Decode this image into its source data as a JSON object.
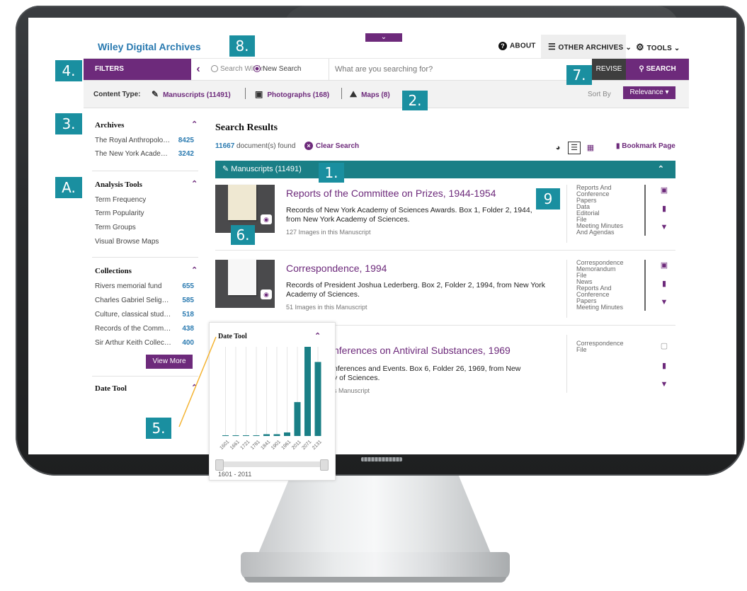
{
  "app": {
    "brand": "Wiley Digital Archives",
    "top_links": {
      "about": "ABOUT",
      "other_archives": "OTHER ARCHIVES",
      "tools": "TOOLS"
    }
  },
  "search": {
    "filters_label": "FILTERS",
    "search_within": "Search Within",
    "new_search": "New Search",
    "placeholder": "What are you searching for?",
    "revise": "REVISE",
    "search_button": "SEARCH"
  },
  "content_type": {
    "label": "Content Type:",
    "manuscripts": "Manuscripts (11491)",
    "photographs": "Photographs (168)",
    "maps": "Maps (8)",
    "sort_label": "Sort By",
    "sort_value": "Relevance"
  },
  "left": {
    "archives_title": "Archives",
    "archives": [
      {
        "label": "The Royal Anthropologic...",
        "count": "8425"
      },
      {
        "label": "The New York Academy ...",
        "count": "3242"
      }
    ],
    "analysis_title": "Analysis Tools",
    "analysis_items": [
      "Term Frequency",
      "Term Popularity",
      "Term Groups",
      "Visual Browse Maps"
    ],
    "collections_title": "Collections",
    "collections": [
      {
        "label": "Rivers memorial fund",
        "count": "655"
      },
      {
        "label": "Charles Gabriel Seligma...",
        "count": "585"
      },
      {
        "label": "Culture, classical studies...",
        "count": "518"
      },
      {
        "label": "Records of the Committ...",
        "count": "438"
      },
      {
        "label": "Sir Arthur Keith Collection",
        "count": "400"
      }
    ],
    "view_more": "View More",
    "date_tool_title": "Date Tool"
  },
  "main": {
    "results_title": "Search Results",
    "found_count": "11667",
    "found_suffix": "document(s) found",
    "clear_search": "Clear Search",
    "bookmark_page": "Bookmark Page",
    "group_label": "Manuscripts (11491)",
    "results": [
      {
        "title": "Reports of the Committee on Prizes, 1944-1954",
        "desc": "Records of New York Academy of Sciences Awards. Box 1, Folder 2, 1944, from New York Academy of Sciences.",
        "meta": "127 Images in this Manuscript",
        "tags": [
          "Reports And",
          "Conference",
          "Papers",
          "Data",
          "Editorial",
          "File",
          "Meeting Minutes",
          "And Agendas"
        ]
      },
      {
        "title": "Correspondence, 1994",
        "desc": "Records of President Joshua Lederberg. Box 2, Folder 2, 1994, from New York Academy of Sciences.",
        "meta": "51 Images in this Manuscript",
        "tags": [
          "Correspondence",
          "Memorandum",
          "File",
          "News",
          "Reports And",
          "Conference",
          "Papers",
          "Meeting Minutes"
        ]
      },
      {
        "title": "nferences on Antiviral Substances, 1969",
        "desc_line1": "nferences and Events. Box 6, Folder 26, 1969, from New",
        "desc_line2": "y of Sciences.",
        "meta": "s Manuscript",
        "tags": [
          "Correspondence",
          "File"
        ]
      }
    ]
  },
  "date_tool": {
    "title": "Date Tool",
    "range": "1601 - 2011",
    "chart_data": {
      "type": "bar",
      "title": "",
      "categories": [
        "1601",
        "1661",
        "1721",
        "1781",
        "1841",
        "1901",
        "1961",
        "2011",
        "2071",
        "2131"
      ],
      "values": [
        0,
        0,
        0,
        0,
        2,
        2,
        4,
        38,
        100,
        83
      ],
      "ylim": [
        0,
        100
      ]
    }
  },
  "callouts": [
    "1.",
    "2.",
    "3.",
    "4.",
    "5.",
    "6.",
    "7.",
    "8.",
    "9",
    "A."
  ],
  "colors": {
    "brand_purple": "#6d2a7b",
    "teal": "#1a7f86",
    "callout": "#1a8fa0",
    "link_blue": "#2a7ab0"
  }
}
